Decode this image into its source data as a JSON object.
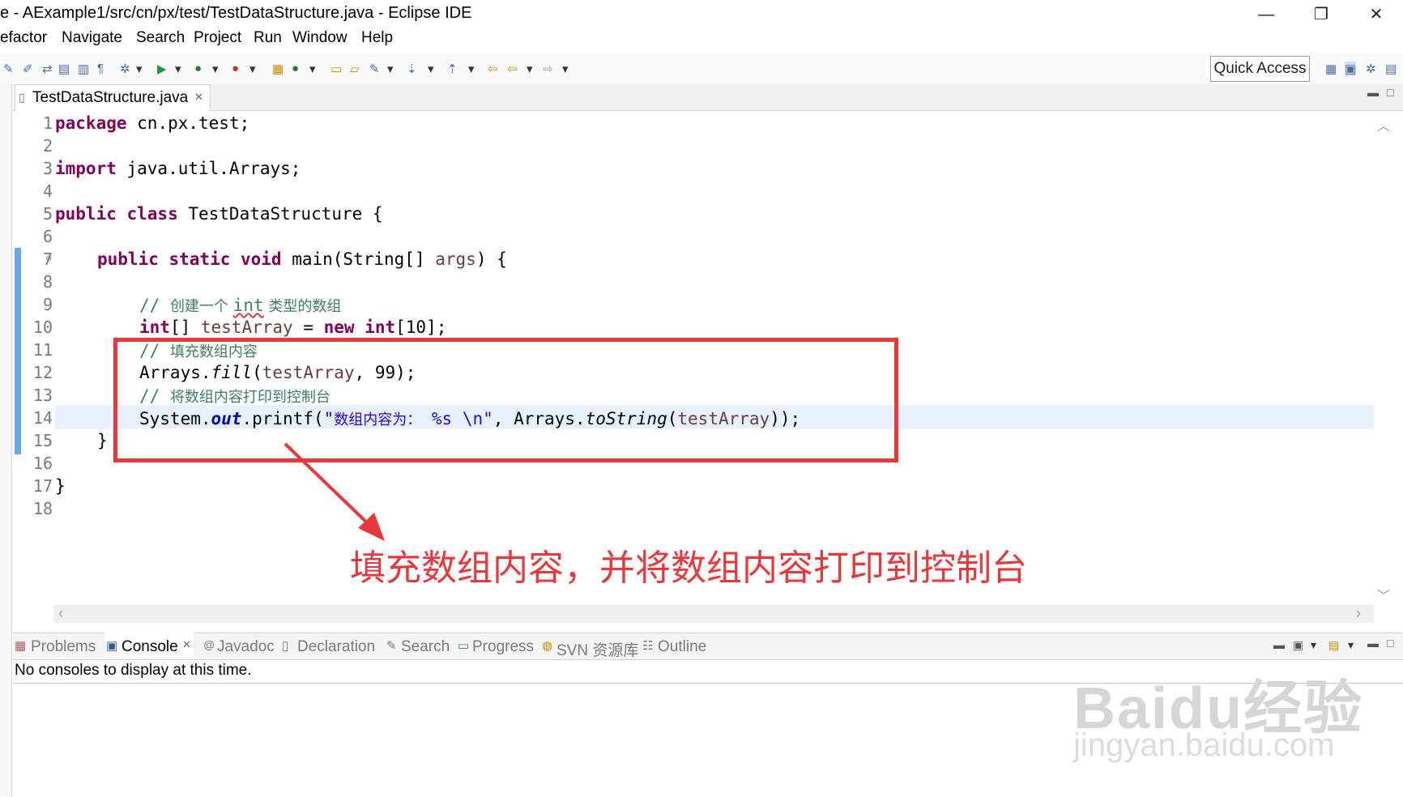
{
  "window": {
    "title": "e - AExample1/src/cn/px/test/TestDataStructure.java - Eclipse IDE",
    "minimize": "—",
    "maximize": "❐",
    "close": "✕"
  },
  "menu": [
    "efactor",
    "Navigate",
    "Search",
    "Project",
    "Run",
    "Window",
    "Help"
  ],
  "toolbar": {
    "quick_access": "Quick Access"
  },
  "editor": {
    "tab_label": "TestDataStructure.java",
    "tab_close": "✕",
    "line_numbers": [
      "1",
      "2",
      "3",
      "4",
      "5",
      "6",
      "7",
      "8",
      "9",
      "10",
      "11",
      "12",
      "13",
      "14",
      "15",
      "16",
      "17",
      "18"
    ],
    "code": {
      "l1_kw": "package",
      "l1_rest": " cn.px.test;",
      "l3_kw": "import",
      "l3_rest": " java.util.Arrays;",
      "l5_kw": "public class",
      "l5_rest": " TestDataStructure {",
      "l7_kw": "public static void",
      "l7_a": " main(String[] ",
      "l7_var": "args",
      "l7_b": ") {",
      "l9_c1": "// ",
      "l9_c2": "创建一个 ",
      "l9_c3": "int",
      "l9_c4": " 类型的数组",
      "l10_kw1": "int",
      "l10_a": "[] ",
      "l10_var": "testArray",
      "l10_b": " = ",
      "l10_kw2": "new",
      "l10_c": " ",
      "l10_kw3": "int",
      "l10_d": "[10];",
      "l11_c1": "// ",
      "l11_c2": "填充数组内容",
      "l12_a": "Arrays.",
      "l12_m": "fill",
      "l12_b": "(",
      "l12_var": "testArray",
      "l12_c": ", 99);",
      "l13_c1": "// ",
      "l13_c2": "将数组内容打印到控制台",
      "l14_a": "System.",
      "l14_f": "out",
      "l14_b": ".printf(",
      "l14_s1": "\"",
      "l14_s2": "数组内容为：",
      "l14_s3": " %s \\n\"",
      "l14_c": ", Arrays.",
      "l14_m": "toString",
      "l14_d": "(",
      "l14_var": "testArray",
      "l14_e": "));",
      "l15": "}",
      "l17": "}"
    }
  },
  "annotation": {
    "text": "填充数组内容，并将数组内容打印到控制台",
    "color": "#e8383c"
  },
  "panel": {
    "tabs": [
      "Problems",
      "Console",
      "Javadoc",
      "Declaration",
      "Search",
      "Progress",
      "SVN 资源库",
      "Outline"
    ],
    "active_tab": "Console",
    "console_message": "No consoles to display at this time."
  },
  "watermark": {
    "line1": "Baidu经验",
    "line2": "jingyan.baidu.com"
  }
}
